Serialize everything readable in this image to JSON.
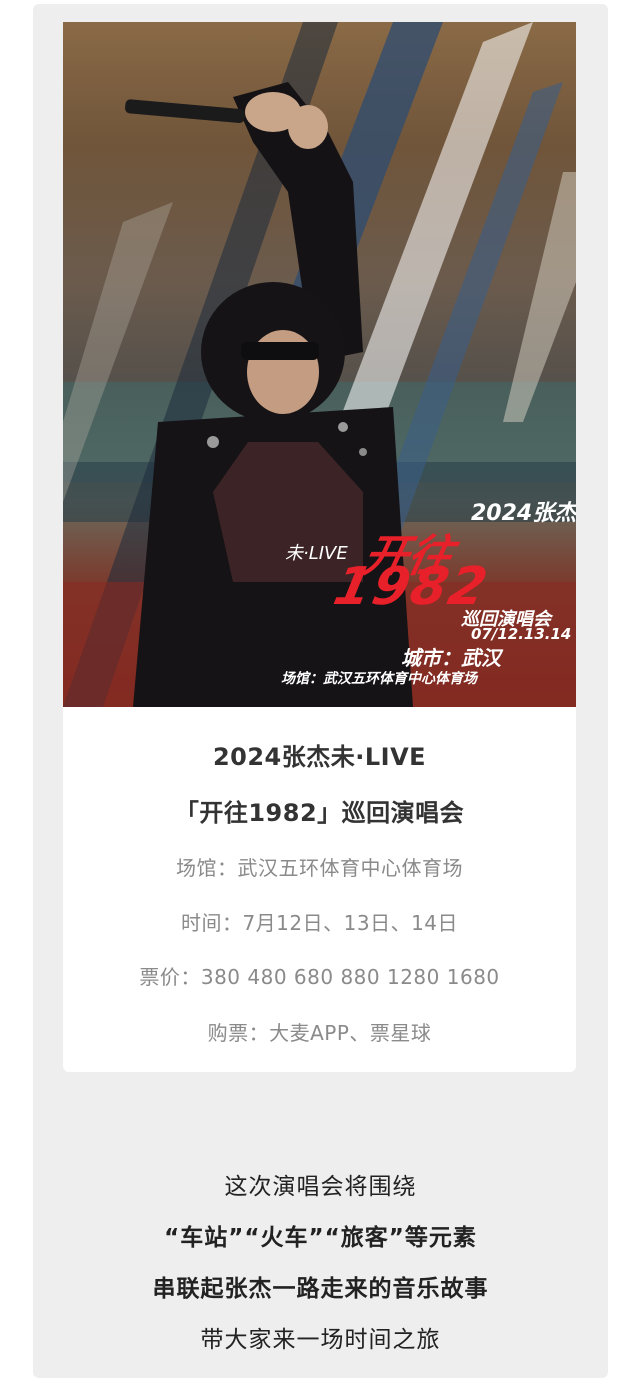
{
  "poster": {
    "year_artist": "2024张杰",
    "live_mark": "未·LIVE",
    "main_title_1": "开往",
    "main_title_2": "1982",
    "tour": "巡回演唱会",
    "dates": "07/12.13.14",
    "city": "城市：武汉",
    "venue": "场馆：武汉五环体育中心体育场"
  },
  "info": {
    "title_line1": "2024张杰未·LIVE",
    "title_line2": "「开往1982」巡回演唱会",
    "venue": "场馆：武汉五环体育中心体育场",
    "time": "时间：7月12日、13日、14日",
    "price": "票价：380 480 680 880 1280 1680",
    "purchase": "购票：大麦APP、票星球"
  },
  "caption": {
    "line1": "这次演唱会将围绕",
    "line2": "“车站”“火车”“旅客”等元素",
    "line3": "串联起张杰一路走来的音乐故事",
    "line4": "带大家来一场时间之旅"
  }
}
